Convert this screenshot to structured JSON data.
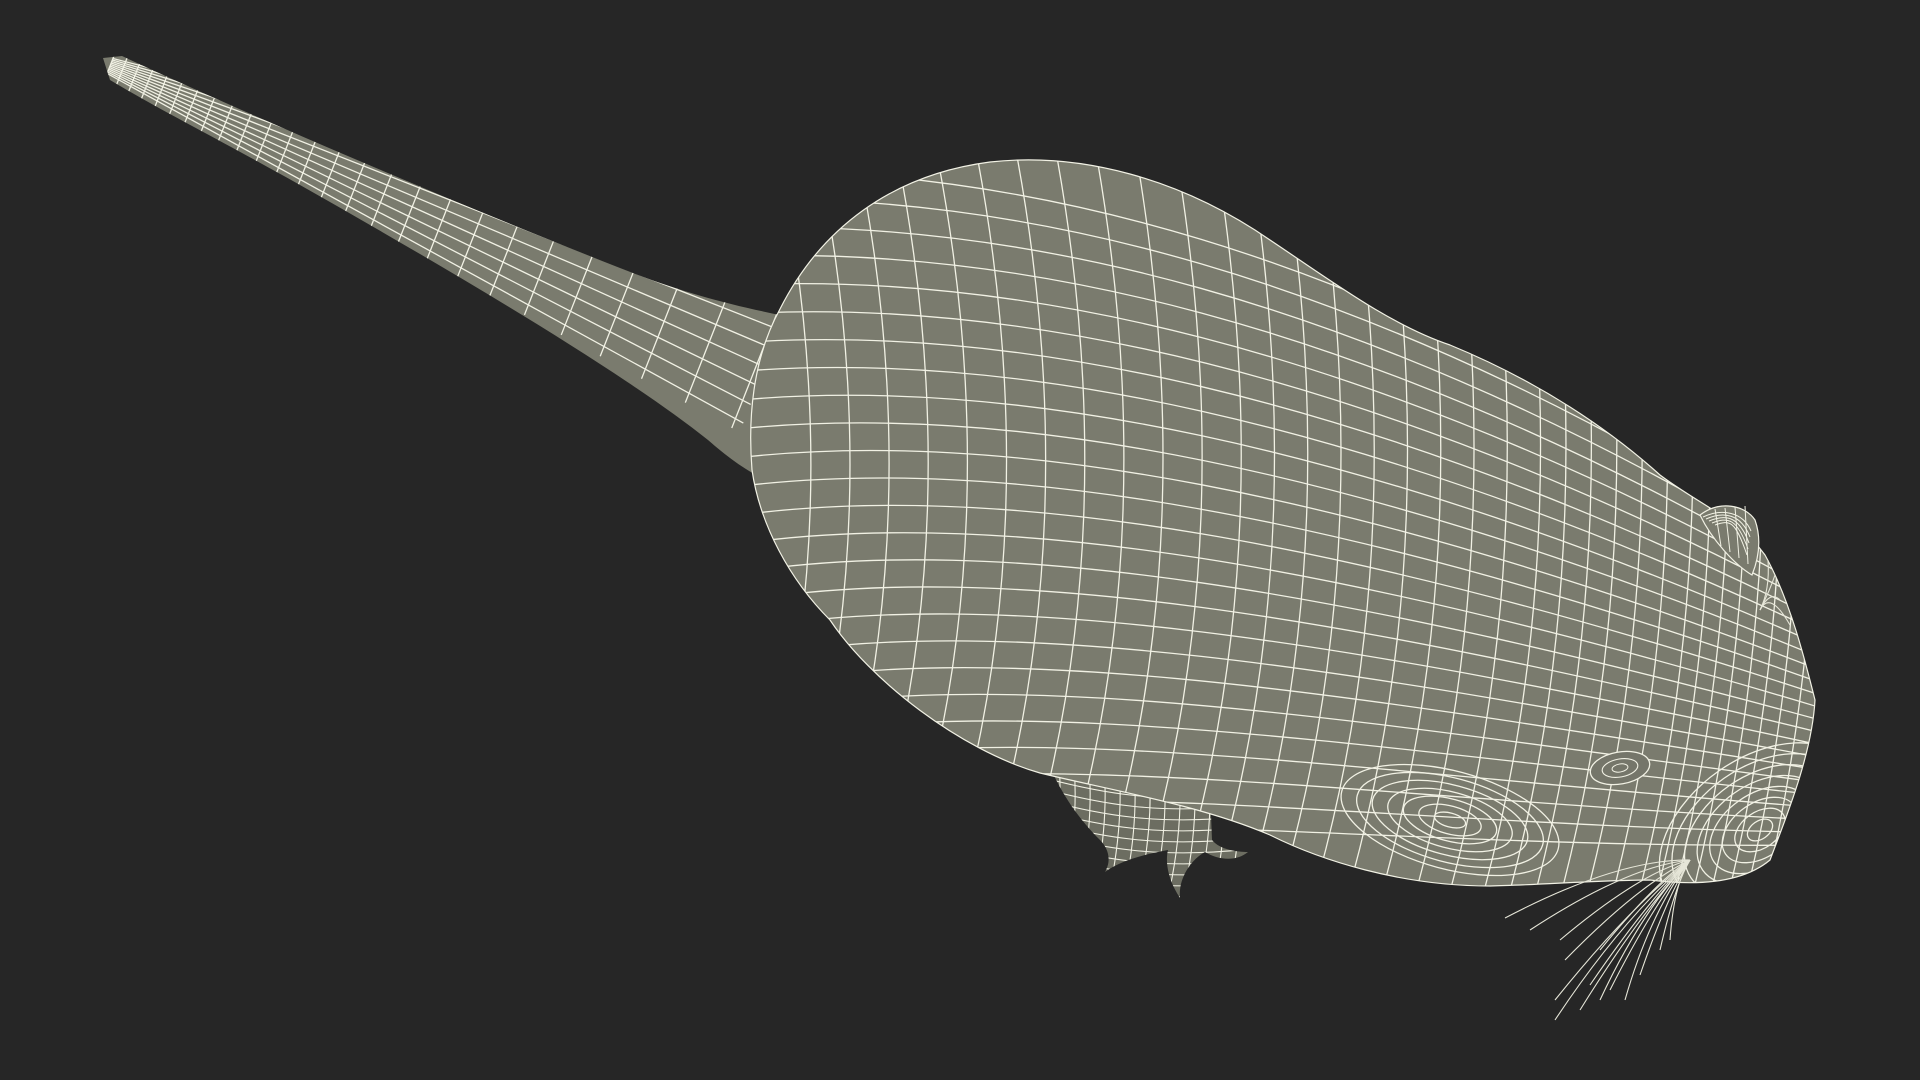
{
  "scene": {
    "subject": "rat-wireframe-model",
    "colors": {
      "background": "#262626",
      "surface": "#7a7b6e",
      "surface_shadow": "#6c6d61",
      "wire": "#f1f1e4",
      "whisker": "#e6e6d8"
    }
  }
}
